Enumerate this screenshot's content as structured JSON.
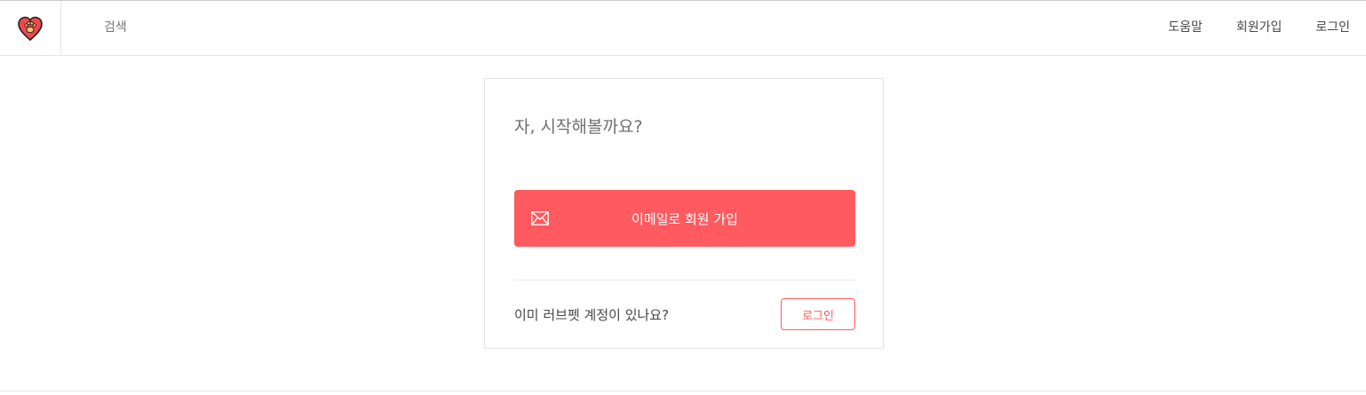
{
  "header": {
    "logo_icon": "heart-paw-logo-icon",
    "search_label": "검색",
    "nav": {
      "help": "도움말",
      "signup": "회원가입",
      "login": "로그인"
    }
  },
  "card": {
    "title": "자, 시작해볼까요?",
    "email_signup_label": "이메일로 회원 가입",
    "email_icon": "envelope-icon",
    "already_text": "이미 러브펫 계정이 있나요?",
    "login_label": "로그인"
  },
  "colors": {
    "brand": "#ff5a5f",
    "text": "#484848",
    "border": "#e4e4e4"
  }
}
